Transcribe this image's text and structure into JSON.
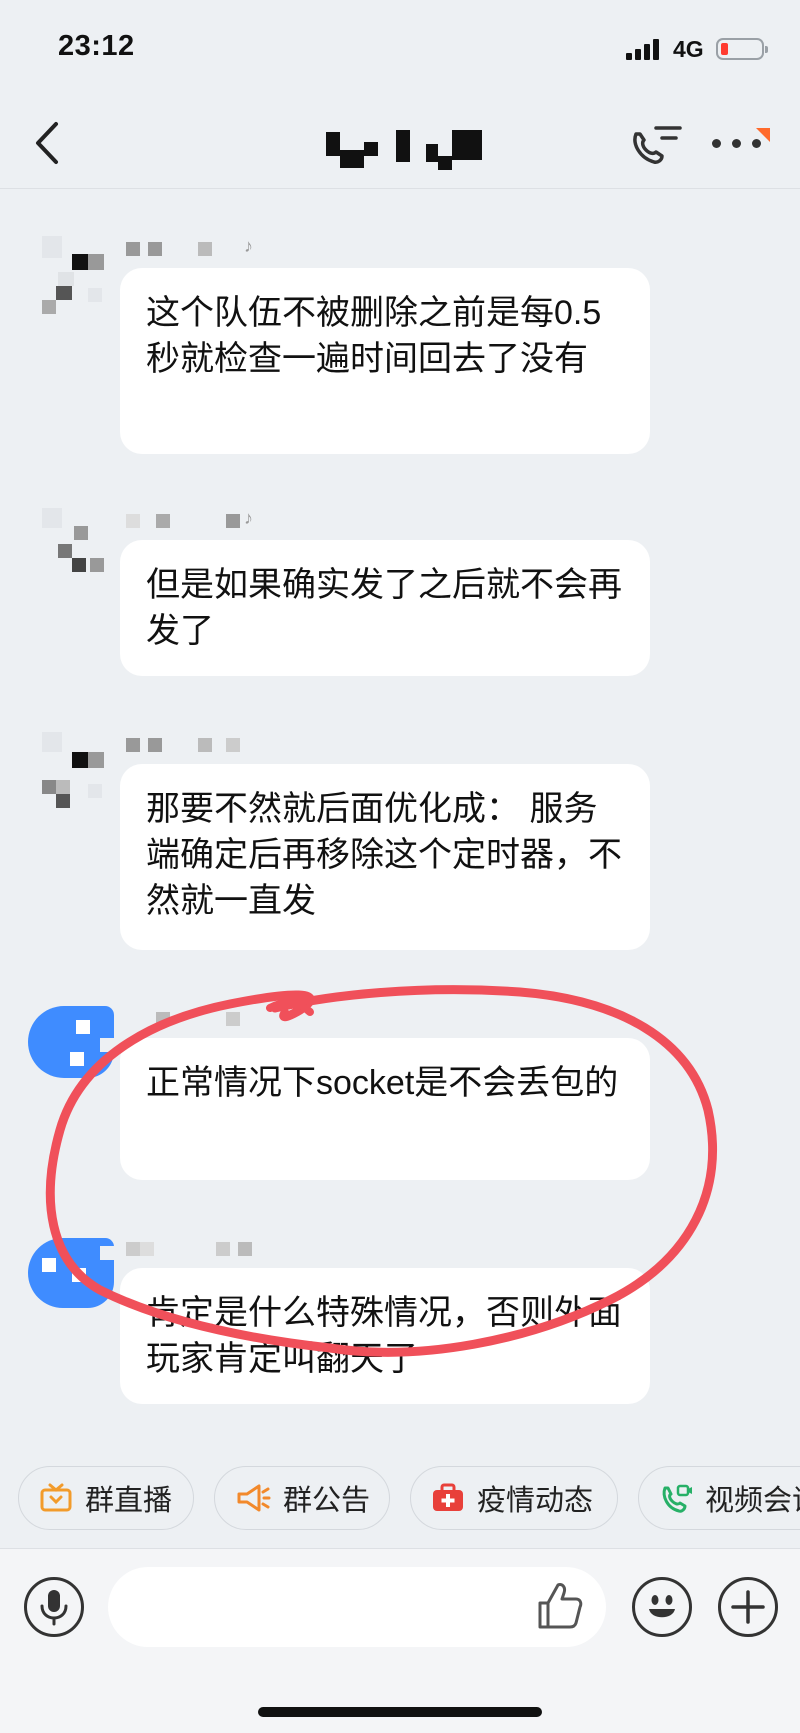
{
  "status_bar": {
    "time": "23:12",
    "network": "4G"
  },
  "colors": {
    "accent": "#3f8cff",
    "annotation": "#f0505a",
    "background": "#edf0f3"
  },
  "messages": [
    {
      "text": "这个队伍不被删除之前是每0.5秒就检查一遍时间回去了没有"
    },
    {
      "text": "但是如果确实发了之后就不会再发了"
    },
    {
      "text": "那要不然就后面优化成： 服务端确定后再移除这个定时器，不然就一直发"
    },
    {
      "text": "正常情况下socket是不会丢包的"
    },
    {
      "text": "肯定是什么特殊情况，否则外面玩家肯定叫翻天了"
    }
  ],
  "quick_actions": [
    {
      "label": "群直播",
      "icon": "tv-icon"
    },
    {
      "label": "群公告",
      "icon": "megaphone-icon"
    },
    {
      "label": "疫情动态",
      "icon": "medical-kit-icon"
    },
    {
      "label": "视频会议",
      "icon": "video-call-icon"
    }
  ],
  "input_bar": {
    "placeholder": ""
  }
}
